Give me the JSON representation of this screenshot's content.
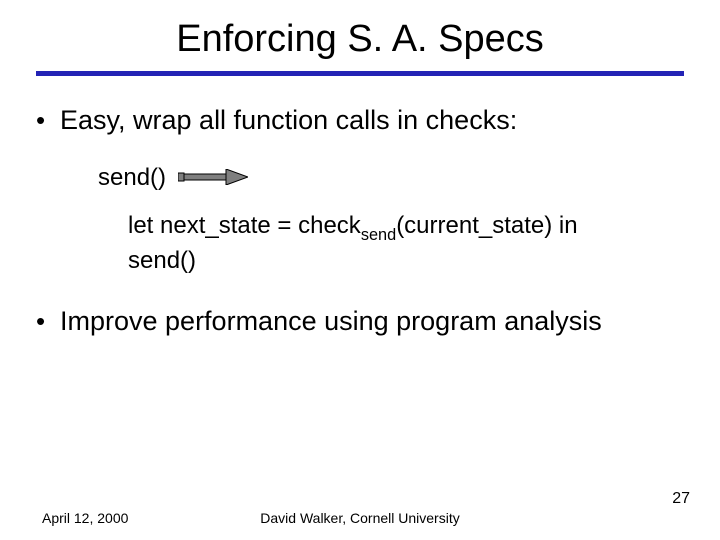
{
  "title": "Enforcing S. A. Specs",
  "bullets": {
    "b1": "Easy, wrap all function calls in checks:",
    "b2": "Improve performance using program analysis"
  },
  "code": {
    "send_before": "send()",
    "let_part": "let next_state = check",
    "sub": "send",
    "after_sub": "(current_state) in",
    "send_after": "send()"
  },
  "footer": {
    "date": "April 12, 2000",
    "center": "David Walker, Cornell University",
    "page": "27"
  }
}
